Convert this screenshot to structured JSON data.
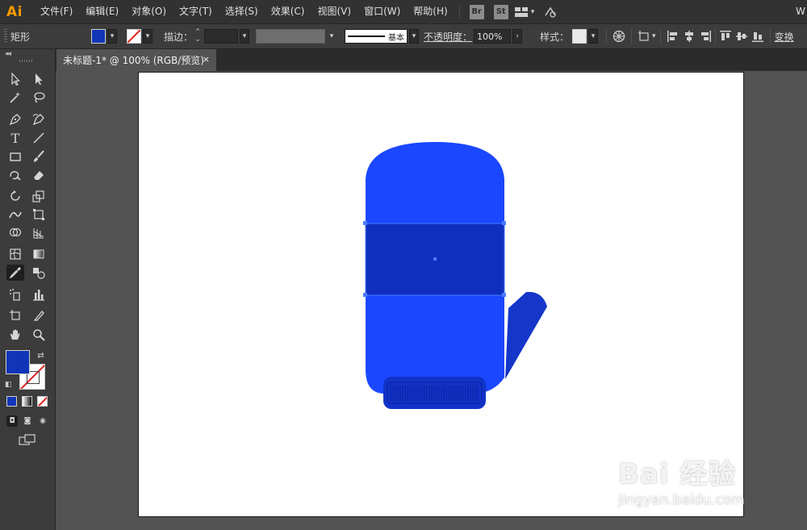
{
  "app": {
    "logo": "Ai"
  },
  "menu": {
    "items": [
      "文件(F)",
      "编辑(E)",
      "对象(O)",
      "文字(T)",
      "选择(S)",
      "效果(C)",
      "视图(V)",
      "窗口(W)",
      "帮助(H)"
    ],
    "bridge_badge": "Br",
    "stock_badge": "St",
    "workspace_label": "W"
  },
  "control_bar": {
    "object_type": "矩形",
    "fill_color": "#1135b8",
    "stroke_label": "描边：",
    "stroke_style": "基本",
    "opacity_label": "不透明度：",
    "opacity_value": "100%",
    "style_label": "样式：",
    "transform_label": "变换"
  },
  "document": {
    "tab_title": "未标题-1* @ 100% (RGB/预览)",
    "close_glyph": "×"
  },
  "tools": [
    {
      "name": "selection-tool-icon"
    },
    {
      "name": "direct-selection-tool-icon"
    },
    {
      "name": "magic-wand-tool-icon"
    },
    {
      "name": "lasso-tool-icon"
    },
    {
      "name": "pen-tool-icon"
    },
    {
      "name": "curvature-tool-icon"
    },
    {
      "name": "type-tool-icon",
      "glyph": "T"
    },
    {
      "name": "line-segment-tool-icon"
    },
    {
      "name": "rectangle-tool-icon"
    },
    {
      "name": "paintbrush-tool-icon"
    },
    {
      "name": "shaper-tool-icon"
    },
    {
      "name": "eraser-tool-icon"
    },
    {
      "name": "rotate-tool-icon"
    },
    {
      "name": "scale-tool-icon"
    },
    {
      "name": "width-tool-icon"
    },
    {
      "name": "free-transform-tool-icon"
    },
    {
      "name": "shape-builder-tool-icon"
    },
    {
      "name": "perspective-grid-tool-icon"
    },
    {
      "name": "mesh-tool-icon"
    },
    {
      "name": "gradient-tool-icon"
    },
    {
      "name": "eyedropper-tool-icon"
    },
    {
      "name": "blend-tool-icon"
    },
    {
      "name": "symbol-sprayer-tool-icon"
    },
    {
      "name": "column-graph-tool-icon"
    },
    {
      "name": "artboard-tool-icon"
    },
    {
      "name": "slice-tool-icon"
    },
    {
      "name": "hand-tool-icon"
    },
    {
      "name": "zoom-tool-icon"
    }
  ],
  "colors": {
    "mitten_body": "#1a47ff",
    "mitten_band": "#0f2fbf",
    "mitten_cuff": "#1233c8",
    "mitten_thumb": "#1436c9",
    "selection": "#4a7bff"
  },
  "watermark": {
    "main": "Bai 经验",
    "sub": "jingyan.baidu.com"
  }
}
